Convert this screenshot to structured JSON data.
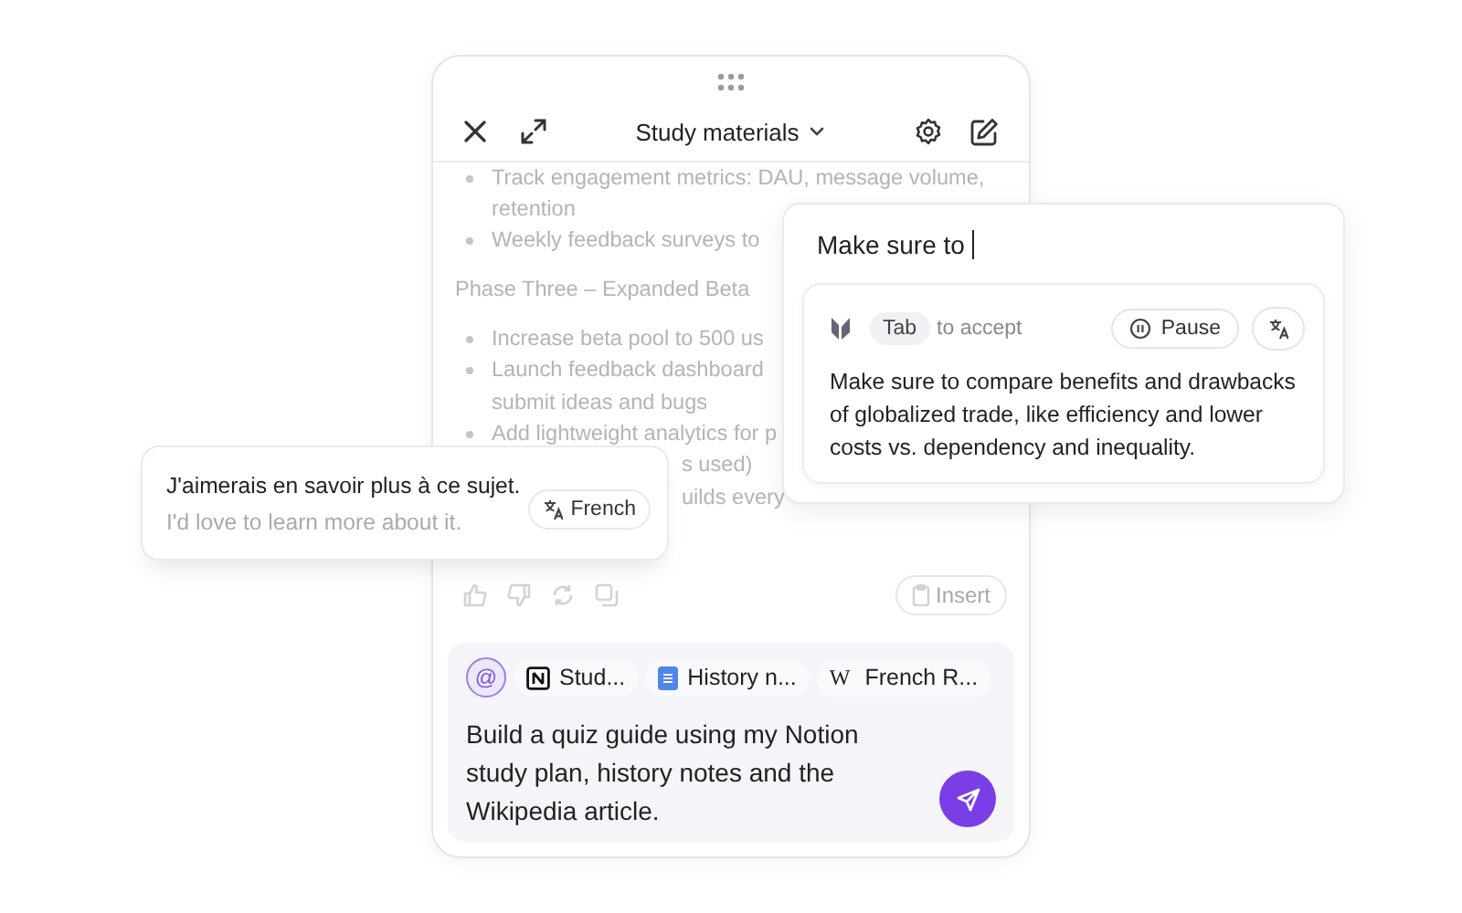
{
  "panel": {
    "title": "Study materials",
    "content": [
      {
        "kind": "bullet",
        "lines": [
          "Track engagement metrics: DAU, message volume,",
          "retention"
        ]
      },
      {
        "kind": "bullet",
        "lines": [
          "Weekly feedback surveys to"
        ]
      },
      {
        "kind": "heading",
        "lines": [
          "Phase Three – Expanded Beta"
        ]
      },
      {
        "kind": "bullet",
        "lines": [
          "Increase beta pool to 500 us"
        ]
      },
      {
        "kind": "bullet",
        "lines": [
          "Launch feedback dashboard",
          "submit ideas and bugs"
        ]
      },
      {
        "kind": "bullet",
        "lines": [
          "Add lightweight analytics for p"
        ]
      },
      {
        "kind": "fragment",
        "lines": [
          "s used)"
        ]
      },
      {
        "kind": "fragment",
        "lines": [
          "uilds every"
        ]
      }
    ],
    "insert_label": "Insert",
    "composer": {
      "chips": [
        {
          "kind": "mention",
          "symbol": "@"
        },
        {
          "kind": "notion",
          "label": "Stud..."
        },
        {
          "kind": "doc",
          "label": "History n..."
        },
        {
          "kind": "wiki",
          "symbol": "W",
          "label": "French R..."
        }
      ],
      "value": "Build a quiz guide using my Notion study plan, history notes and the Wikipedia article."
    }
  },
  "autocomplete": {
    "typed": "Make sure to ",
    "key": "Tab",
    "hint": "to accept",
    "pause_label": "Pause",
    "suggestion": "Make sure to compare benefits and drawbacks of globalized trade, like efficiency and lower costs vs. dependency and inequality."
  },
  "translation": {
    "original": "J'aimerais en savoir plus à ce sujet.",
    "translated": "I'd love to learn more about it.",
    "language": "French"
  }
}
